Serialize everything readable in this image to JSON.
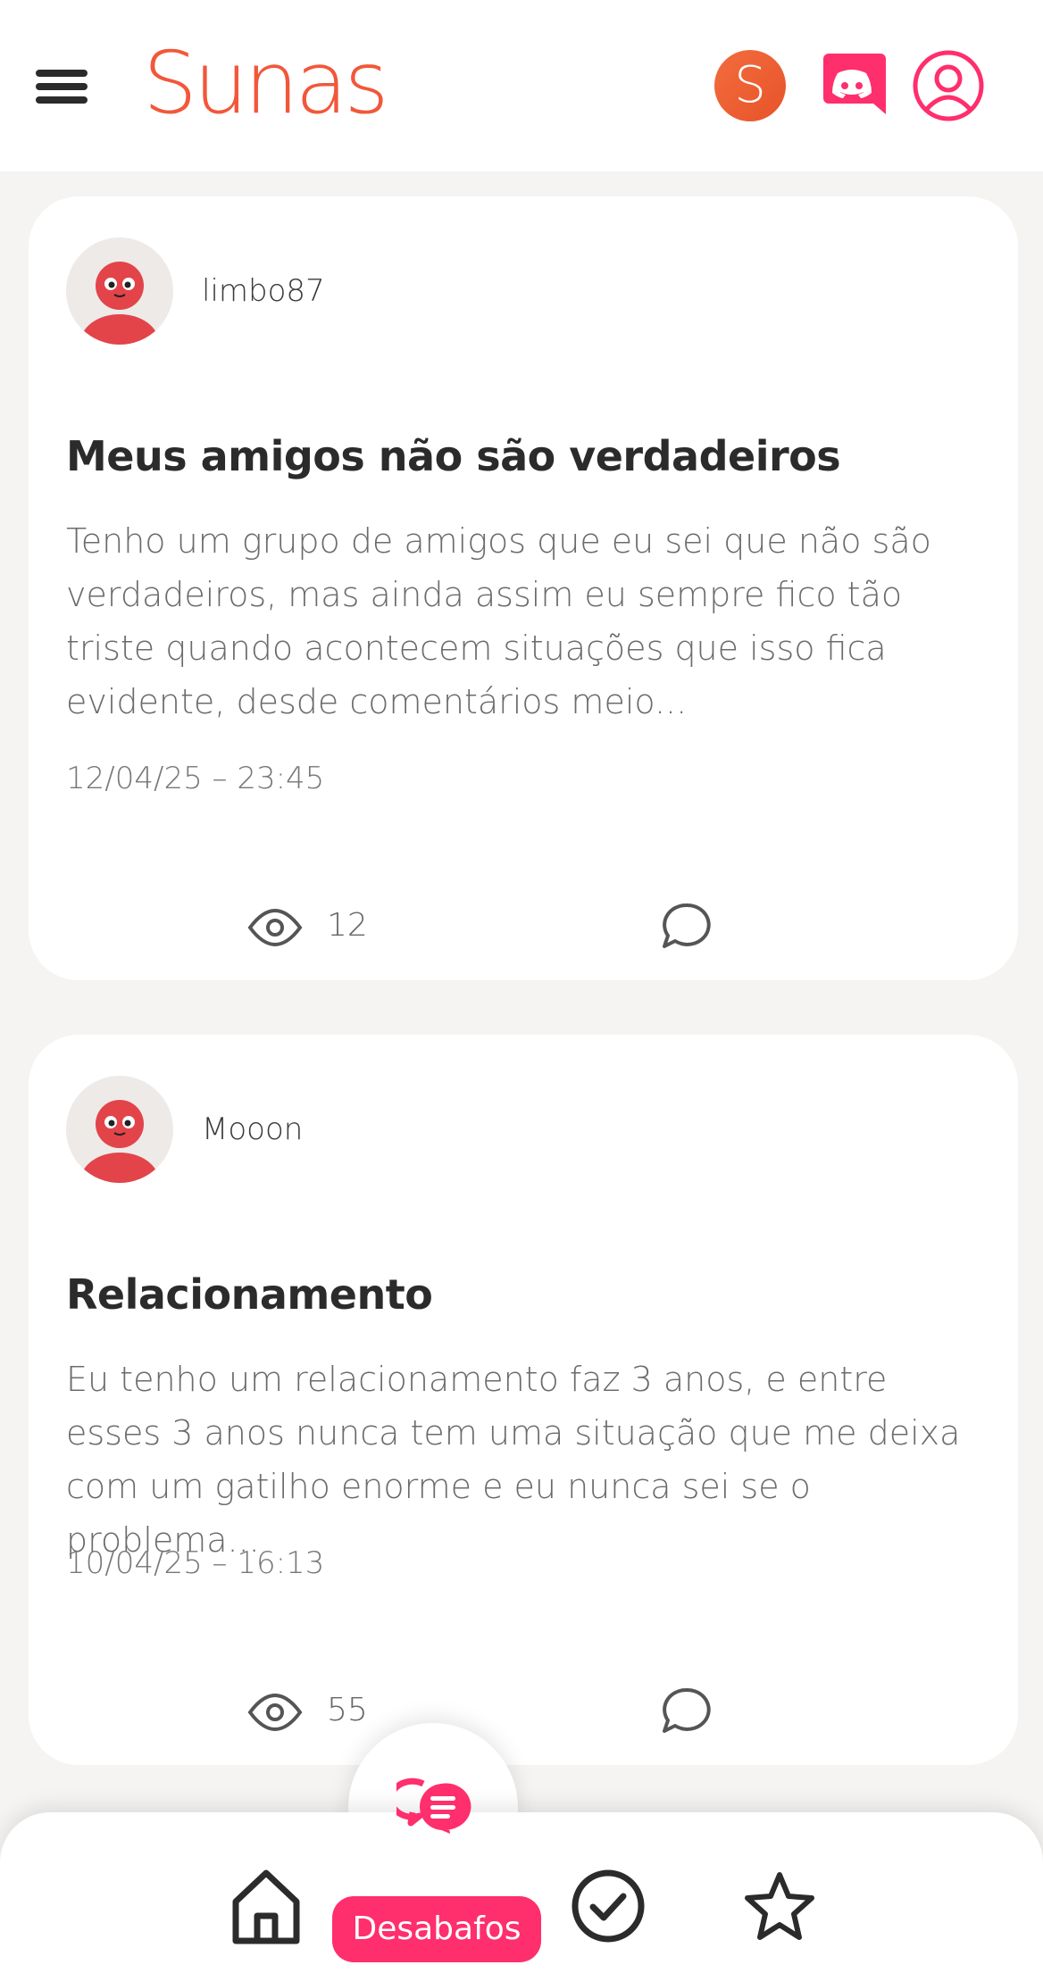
{
  "header": {
    "logo_text": "Sunas",
    "s_badge": "S"
  },
  "posts": [
    {
      "username": "limbo87",
      "title": "Meus amigos não são verdadeiros",
      "excerpt": "Tenho um grupo de amigos que eu sei que não são verdadeiros, mas ainda assim eu sempre fico tão triste quando acontecem situações que isso fica evidente, desde comentários meio...",
      "date": "12/04/25 – 23:45",
      "views": "12"
    },
    {
      "username": "Mooon",
      "title": "Relacionamento",
      "excerpt": "Eu tenho um relacionamento faz 3 anos, e entre esses 3 anos nunca tem uma situação que me deixa com um gatilho enorme e eu nunca sei se o problema...",
      "date": "10/04/25 – 16:13",
      "views": "55"
    }
  ],
  "bottom_nav": {
    "active_label": "Desabafos"
  },
  "colors": {
    "brand_orange": "#f2573a",
    "brand_pink": "#ff2e6d",
    "background": "#f5f4f3"
  },
  "icons": [
    "menu-icon",
    "s-badge-icon",
    "discord-icon",
    "profile-icon",
    "eye-icon",
    "comment-icon",
    "chat-icon",
    "home-icon",
    "check-icon",
    "star-icon"
  ]
}
